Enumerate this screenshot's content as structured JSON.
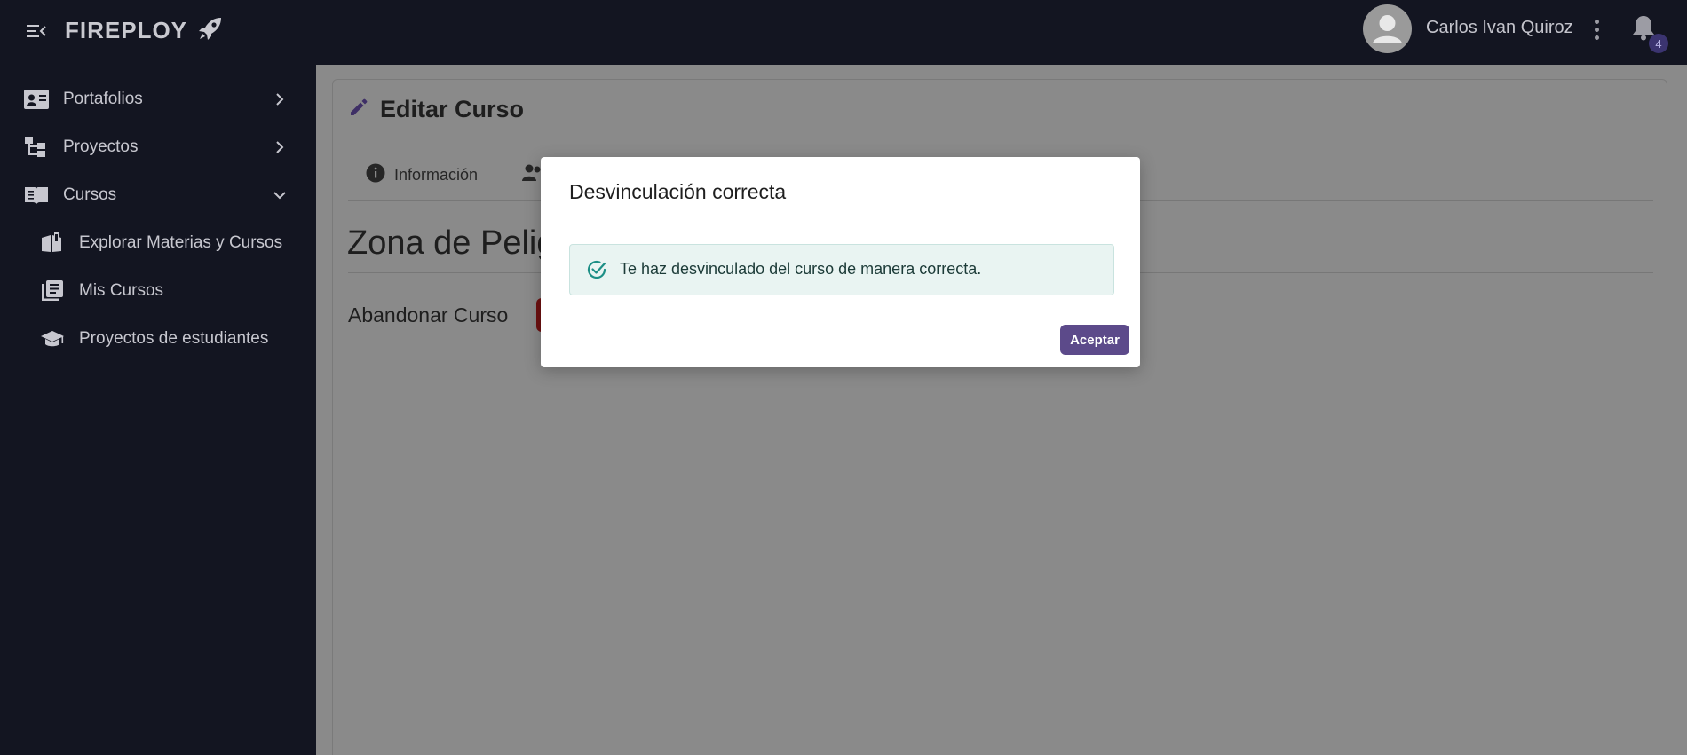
{
  "header": {
    "brand": "FIREPLOY",
    "user_name": "Carlos Ivan Quiroz",
    "notification_count": "4"
  },
  "sidebar": {
    "items": [
      {
        "label": "Portafolios",
        "icon": "id-card-icon",
        "expanded": false
      },
      {
        "label": "Proyectos",
        "icon": "sitemap-icon",
        "expanded": false
      },
      {
        "label": "Cursos",
        "icon": "book-open-icon",
        "expanded": true
      }
    ],
    "sub_items": [
      {
        "label": "Explorar Materias y Cursos",
        "icon": "book-reader-icon"
      },
      {
        "label": "Mis Cursos",
        "icon": "book-list-icon"
      },
      {
        "label": "Proyectos de estudiantes",
        "icon": "graduation-cap-icon"
      }
    ]
  },
  "main": {
    "title": "Editar Curso",
    "tabs": [
      {
        "label": "Información",
        "icon": "info-icon"
      },
      {
        "label": "",
        "icon": "users-icon"
      }
    ],
    "danger_zone_title": "Zona de Pelig",
    "leave_course_label": "Abandonar Curso"
  },
  "modal": {
    "title": "Desvinculación correcta",
    "message": "Te haz desvinculado del curso de manera correcta.",
    "accept_label": "Aceptar"
  },
  "colors": {
    "sidebar_bg": "#131521",
    "accent": "#5c4a8a",
    "overlay_gray": "#8a8a8a",
    "alert_bg": "#e9f4f2",
    "success_icon": "#1d8f86"
  }
}
